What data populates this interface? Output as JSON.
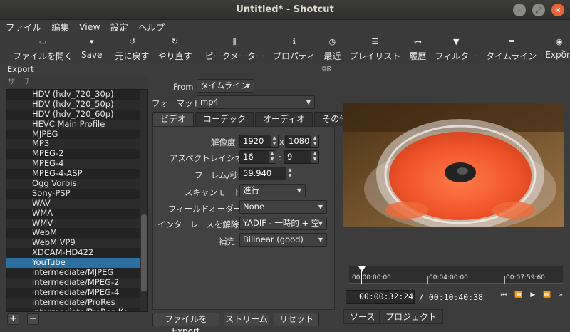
{
  "window": {
    "title": "Untitled* - Shotcut"
  },
  "menu": [
    "ファイル",
    "編集",
    "View",
    "設定",
    "ヘルプ"
  ],
  "toolbar": [
    {
      "icon": "folder-icon",
      "label": "ファイルを開く"
    },
    {
      "icon": "save-icon",
      "label": "Save"
    },
    {
      "icon": "undo-icon",
      "label": "元に戻す"
    },
    {
      "icon": "redo-icon",
      "label": "やり直す"
    },
    {
      "icon": "peak-meter-icon",
      "label": "ピークメーター"
    },
    {
      "icon": "info-icon",
      "label": "プロパティ"
    },
    {
      "icon": "clock-icon",
      "label": "最近"
    },
    {
      "icon": "list-icon",
      "label": "プレイリスト"
    },
    {
      "icon": "history-icon",
      "label": "履歴"
    },
    {
      "icon": "filter-icon",
      "label": "フィルター"
    },
    {
      "icon": "timeline-icon",
      "label": "タイムライン"
    },
    {
      "icon": "export-icon",
      "label": "Export"
    }
  ],
  "export": {
    "title": "Export",
    "search_placeholder": "サーチ",
    "presets": [
      "HDV (hdv_720_30p)",
      "HDV (hdv_720_50p)",
      "HDV (hdv_720_60p)",
      "HEVC Main Profile",
      "MJPEG",
      "MP3",
      "MPEG-2",
      "MPEG-4",
      "MPEG-4-ASP",
      "Ogg Vorbis",
      "Sony-PSP",
      "WAV",
      "WMA",
      "WMV",
      "WebM",
      "WebM VP9",
      "XDCAM-HD422",
      "YouTube",
      "intermediate/MJPEG",
      "intermediate/MPEG-2",
      "intermediate/MPEG-4",
      "intermediate/ProRes",
      "intermediate/ProRes-Ko"
    ],
    "selected": "YouTube",
    "from_label": "From",
    "from_value": "タイムライン",
    "format_label": "フォーマット",
    "format_value": "mp4",
    "tabs": [
      "ビデオ",
      "コーデック",
      "オーディオ",
      "その他"
    ],
    "resolution_label": "解像度",
    "width": "1920",
    "x": "x",
    "height": "1080",
    "aspect_label": "アスペクトレイシオ",
    "aspect_w": "16",
    "colon": ":",
    "aspect_h": "9",
    "fps_label": "フーレム/秒",
    "fps": "59.940",
    "scan_label": "スキャンモード",
    "scan_value": "進行",
    "field_label": "フィールドオーダー",
    "field_value": "None",
    "deint_label": "インターレースを解除",
    "deint_value": "YADIF - 一時的 + 空",
    "interp_label": "補完",
    "interp_value": "Bilinear (good)",
    "buttons": {
      "export": "ファイルをExport",
      "stream": "ストリーム",
      "reset": "リセット"
    }
  },
  "player": {
    "ruler_labels": [
      "00:00:00:00",
      "00:04:00:00",
      "00:07:59:60"
    ],
    "position": "00:00:32:24",
    "duration": "/ 00:10:40:38",
    "tabs": [
      "ソース",
      "プロジェクト"
    ]
  }
}
